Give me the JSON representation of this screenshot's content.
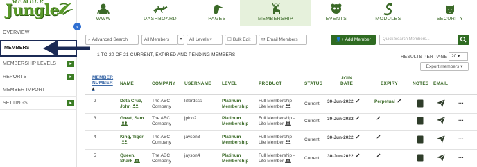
{
  "sidebar": {
    "logo_top": "MEMBER",
    "logo_main": "Jungle",
    "items": [
      {
        "label": "OVERVIEW",
        "active": false,
        "expandable": false
      },
      {
        "label": "MEMBERS",
        "active": true,
        "expandable": false
      },
      {
        "label": "MEMBERSHIP LEVELS",
        "active": false,
        "expandable": true
      },
      {
        "label": "REPORTS",
        "active": false,
        "expandable": true
      },
      {
        "label": "MEMBER IMPORT",
        "active": false,
        "expandable": false
      },
      {
        "label": "SETTINGS",
        "active": false,
        "expandable": true
      }
    ]
  },
  "topnav": {
    "tabs": [
      {
        "label": "WWW",
        "icon": "gorilla-icon",
        "active": false
      },
      {
        "label": "DASHBOARD",
        "icon": "lizard-icon",
        "active": false
      },
      {
        "label": "PAGES",
        "icon": "toucan-icon",
        "active": false
      },
      {
        "label": "MEMBERSHIP",
        "icon": "deer-icon",
        "active": true
      },
      {
        "label": "EVENTS",
        "icon": "panda-icon",
        "active": false
      },
      {
        "label": "MODULES",
        "icon": "snake-icon",
        "active": false
      },
      {
        "label": "SECURITY",
        "icon": "tiger-icon",
        "active": false
      }
    ]
  },
  "toolbar": {
    "advanced_search": "Advanced Search",
    "all_members": "All Members",
    "all_levels": "All Levels",
    "bulk_edit": "Bulk Edit",
    "email_members": "Email Members",
    "add_member": "Add Member",
    "search_placeholder": "Quick Search Members..."
  },
  "summary": {
    "count_text": "1 TO 20 OF 21 CURRENT, EXPIRED AND PENDING MEMBERS",
    "results_per_page_label": "RESULTS PER PAGE",
    "results_per_page_value": "20",
    "export_label": "Export members"
  },
  "table": {
    "headers": {
      "member_number_1": "MEMBER",
      "member_number_2": "NUMBER",
      "name": "NAME",
      "company": "COMPANY",
      "username": "USERNAME",
      "level": "LEVEL",
      "product": "PRODUCT",
      "status": "STATUS",
      "join_date_1": "JOIN",
      "join_date_2": "DATE",
      "expiry": "EXPIRY",
      "notes": "NOTES",
      "email": "EMAIL"
    },
    "rows": [
      {
        "number": "2",
        "name_1": "Deta Cruz,",
        "name_2": "John",
        "company_1": "The ABC",
        "company_2": "Company",
        "username": "lizardsss",
        "level_1": "Platinum",
        "level_2": "Membership",
        "product_1": "Full Membership -",
        "product_2": "Life Member",
        "status": "Current",
        "join_date": "30-Jun-2022",
        "expiry": "Perpetual"
      },
      {
        "number": "3",
        "name_1": "Great, Sam",
        "name_2": "",
        "company_1": "The ABC",
        "company_2": "Company",
        "username": "jpido2",
        "level_1": "Platinum",
        "level_2": "Membership",
        "product_1": "Full Membership -",
        "product_2": "Life Member",
        "status": "Current",
        "join_date": "30-Jun-2022",
        "expiry": ""
      },
      {
        "number": "4",
        "name_1": "King, Tiger",
        "name_2": "",
        "company_1": "The ABC",
        "company_2": "Company",
        "username": "jayson3",
        "level_1": "Platinum",
        "level_2": "Membership",
        "product_1": "Full Membership -",
        "product_2": "Life Member",
        "status": "Current",
        "join_date": "30-Jun-2022",
        "expiry": ""
      },
      {
        "number": "5",
        "name_1": "Queen,",
        "name_2": "Shark",
        "company_1": "The ABC",
        "company_2": "Company",
        "username": "jayson4",
        "level_1": "Platinum",
        "level_2": "Membership",
        "product_1": "Full Membership -",
        "product_2": "Life Member",
        "status": "Current",
        "join_date": "30-Jun-2022",
        "expiry": ""
      }
    ]
  },
  "colors": {
    "brand_green": "#2f6b22",
    "label_green": "#3b6a28",
    "active_tab_bg": "#e6f1dc",
    "annotation_navy": "#1b2a55",
    "link_blue": "#3d6aa8"
  }
}
